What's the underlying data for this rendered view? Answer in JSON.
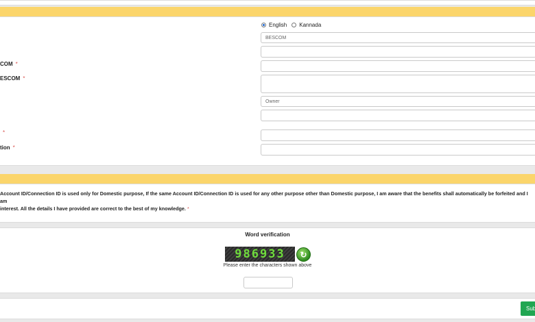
{
  "form": {
    "language": {
      "english": "English",
      "kannada": "Kannada",
      "selected": "English"
    },
    "company_value": "BESCOM",
    "labels": {
      "escom_field1": "COM",
      "escom_field2": "ESCOM",
      "field_a": "",
      "field_b": "tion",
      "required_mark": "*"
    },
    "ownership_value": "Owner"
  },
  "declaration": {
    "line1": "Account ID/Connection ID is used only for Domestic purpose, If the same Account ID/Connection ID is used for any other purpose other than Domestic purpose, I am aware that the benefits shall automatically be forfeited and I am",
    "line2": "interest. All the details I have provided are correct to the best of my knowledge.",
    "required_mark": "*"
  },
  "verification": {
    "title": "Word verification",
    "captcha_text": "986933",
    "hint": "Please enter the characters shown above"
  },
  "actions": {
    "submit_label": "Sub"
  },
  "colors": {
    "band": "#fbd56b",
    "submit": "#21a652",
    "captcha_text": "#6fdc3c"
  }
}
